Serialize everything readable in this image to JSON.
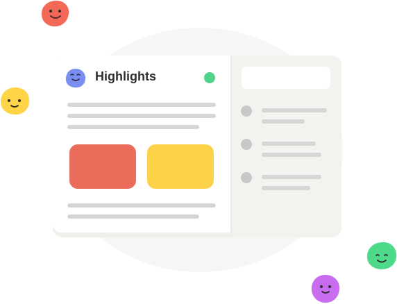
{
  "card": {
    "title": "Highlights",
    "status_color": "#4fd28a",
    "status_icon": "status-dot",
    "avatar_icon": "smiley-blob-icon"
  },
  "tiles": [
    {
      "name": "tile-red",
      "color": "#e96d5a"
    },
    {
      "name": "tile-yellow",
      "color": "#fdd249"
    }
  ],
  "side_panel": {
    "search_placeholder": "",
    "list_items": 3
  },
  "decorations": [
    {
      "name": "smiley-blob-red",
      "color": "#f36856"
    },
    {
      "name": "smiley-blob-yellow",
      "color": "#ffd447"
    },
    {
      "name": "smiley-blob-green",
      "color": "#4fd98a"
    },
    {
      "name": "smiley-blob-purple",
      "color": "#c86df0"
    },
    {
      "name": "smiley-blob-blue",
      "color": "#7a8ff2"
    }
  ]
}
